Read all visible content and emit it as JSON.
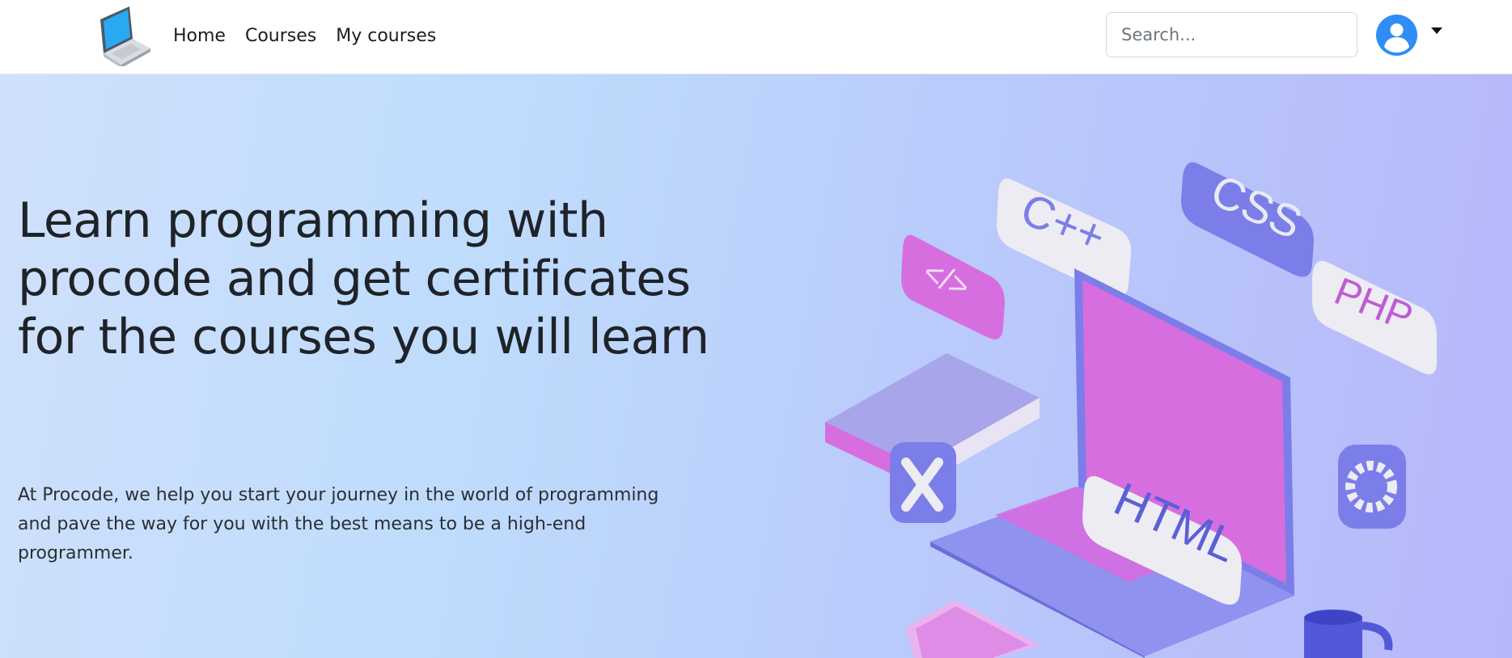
{
  "navbar": {
    "logo_icon": "laptop-icon",
    "links": [
      "Home",
      "Courses",
      "My courses"
    ],
    "search": {
      "placeholder": "Search...",
      "value": ""
    },
    "user_icon": "user-avatar-icon",
    "menu_icon": "caret-down-icon"
  },
  "hero": {
    "title": "Learn programming with procode and get certificates for the courses you will learn",
    "description": "At Procode, we help you start your journey in the world of programming and pave the way for you with the best means to be a high-end programmer.",
    "illustration": {
      "tiles": [
        "C++",
        "CSS",
        "PHP",
        "</>",
        "HTML"
      ]
    }
  },
  "colors": {
    "accent_blue": "#2f8ef5",
    "hero_gradient_start": "#cfe0fb",
    "hero_gradient_end": "#b6b7fa",
    "tile_purple": "#7b7ee8",
    "tile_pink": "#d66ee0"
  }
}
